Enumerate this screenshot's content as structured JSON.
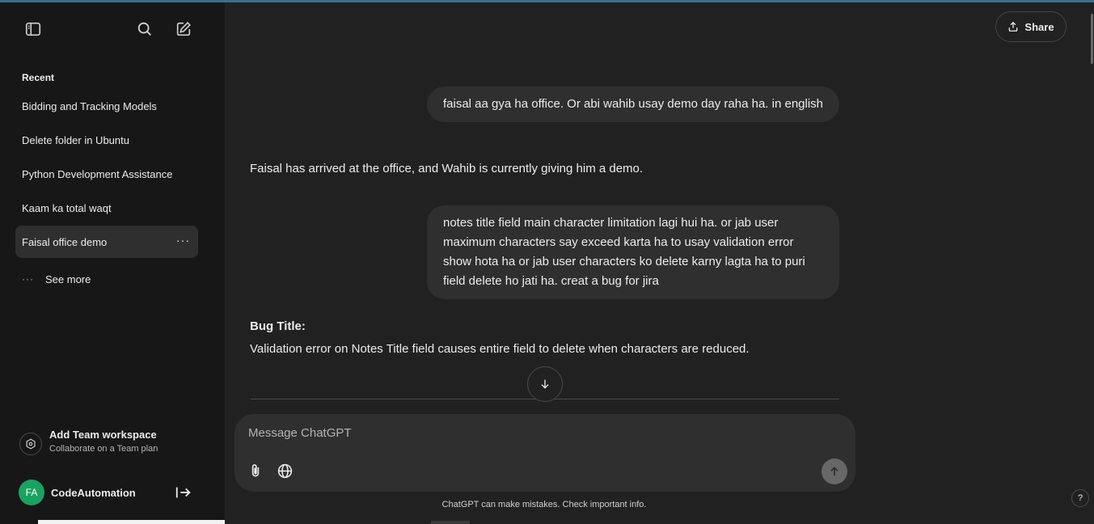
{
  "sidebar": {
    "toggle_icon": "sidebar-toggle-icon",
    "search_icon": "search-icon",
    "new_chat_icon": "compose-icon",
    "recent_label": "Recent",
    "history": [
      {
        "label": "Bidding and Tracking Models"
      },
      {
        "label": "Delete folder in Ubuntu"
      },
      {
        "label": "Python Development Assistance"
      },
      {
        "label": "Kaam ka total waqt"
      },
      {
        "label": "Faisal office demo",
        "active": true
      }
    ],
    "item_options": "···",
    "see_more_dots": "···",
    "see_more": "See more",
    "team": {
      "title": "Add Team workspace",
      "subtitle": "Collaborate on a Team plan"
    },
    "user": {
      "initials": "FA",
      "name": "CodeAutomation"
    }
  },
  "header": {
    "share_label": "Share"
  },
  "conversation": {
    "messages": [
      {
        "role": "user",
        "text": "faisal aa gya ha office. Or abi wahib usay demo day raha ha. in english"
      },
      {
        "role": "assistant",
        "text": "Faisal has arrived at the office, and Wahib is currently giving him a demo."
      },
      {
        "role": "user",
        "text": "notes title field main character limitation lagi hui ha. or jab user maximum characters say exceed karta ha to usay validation error show hota ha or jab user characters ko delete karny lagta ha to puri field delete ho jati ha. creat a bug for jira"
      },
      {
        "role": "assistant",
        "heading": "Bug Title:",
        "text": "Validation error on Notes Title field causes entire field to delete when characters are reduced."
      }
    ]
  },
  "composer": {
    "placeholder": "Message ChatGPT",
    "attach_icon": "paperclip-icon",
    "web_icon": "globe-icon",
    "send_icon": "arrow-up-icon"
  },
  "disclaimer": "ChatGPT can make mistakes. Check important info.",
  "help_label": "?",
  "colors": {
    "sidebar_bg": "#171717",
    "main_bg": "#212121",
    "bubble_bg": "#2f2f2f",
    "avatar_bg": "#1aa260"
  }
}
